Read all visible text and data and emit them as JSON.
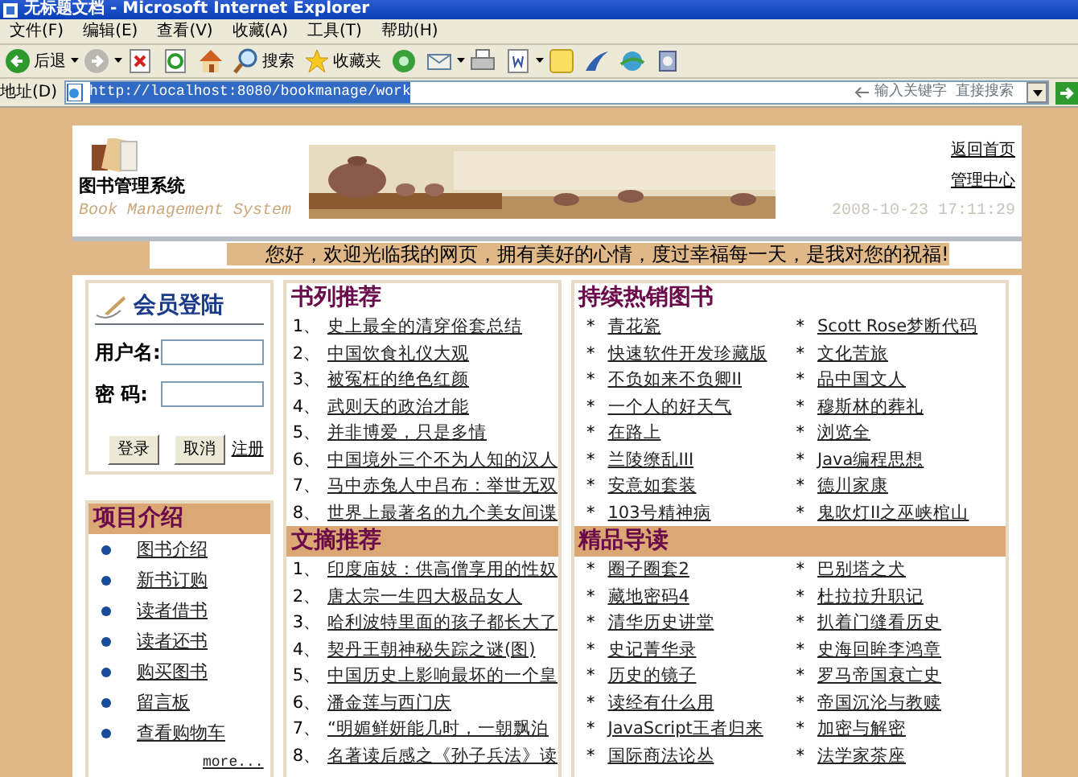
{
  "window": {
    "title": "无标题文档 - Microsoft Internet Explorer"
  },
  "menu": [
    "文件(F)",
    "编辑(E)",
    "查看(V)",
    "收藏(A)",
    "工具(T)",
    "帮助(H)"
  ],
  "toolbar": {
    "back_label": "后退",
    "search_label": "搜索",
    "favorites_label": "收藏夹"
  },
  "address_bar": {
    "label": "地址(D)",
    "url": "http://localhost:8080/bookmanage/work",
    "search_hint": "输入关键字 直接搜索"
  },
  "header": {
    "logo_title": "图书管理系统",
    "logo_subtitle": "Book Management System",
    "links": [
      "返回首页",
      "管理中心"
    ],
    "datetime": "2008-10-23 17:11:29"
  },
  "welcome": "您好，欢迎光临我的网页，拥有美好的心情，度过幸福每一天，是我对您的祝福!",
  "login": {
    "title": "会员登陆",
    "fields": [
      {
        "label": "用户名:"
      },
      {
        "label": "密  码:"
      }
    ],
    "buttons": [
      "登录",
      "取消"
    ],
    "register_link": "注册"
  },
  "project": {
    "title": "项目介绍",
    "items": [
      "图书介绍",
      "新书订购",
      "读者借书",
      "读者还书",
      "购买图书",
      "留言板",
      "查看购物车"
    ],
    "more": "more..."
  },
  "book_recs": {
    "title": "书列推荐",
    "items": [
      {
        "num": "1、",
        "title": "史上最全的清穿俗套总结"
      },
      {
        "num": "2、",
        "title": "中国饮食礼仪大观"
      },
      {
        "num": "3、",
        "title": "被冤枉的绝色红颜"
      },
      {
        "num": "4、",
        "title": "武则天的政治才能"
      },
      {
        "num": "5、",
        "title": "并非博爱，只是多情"
      },
      {
        "num": "6、",
        "title": "中国境外三个不为人知的汉人"
      },
      {
        "num": "7、",
        "title": "马中赤兔人中吕布：举世无双"
      },
      {
        "num": "8、",
        "title": "世界上最著名的九个美女间谍"
      }
    ]
  },
  "digest": {
    "title": "文摘推荐",
    "items": [
      {
        "num": "1、",
        "title": "印度庙妓：供高僧享用的性奴"
      },
      {
        "num": "2、",
        "title": "唐太宗一生四大极品女人"
      },
      {
        "num": "3、",
        "title": "哈利波特里面的孩子都长大了"
      },
      {
        "num": "4、",
        "title": "契丹王朝神秘失踪之谜(图)"
      },
      {
        "num": "5、",
        "title": "中国历史上影响最坏的一个皇"
      },
      {
        "num": "6、",
        "title": "潘金莲与西门庆"
      },
      {
        "num": "7、",
        "title": "“明媚鲜妍能几时，一朝飘泊"
      },
      {
        "num": "8、",
        "title": "名著读后感之《孙子兵法》读"
      }
    ]
  },
  "bestsellers": {
    "title": "持续热销图书",
    "bullet": "*",
    "items": [
      "青花瓷",
      "Scott Rose梦断代码",
      "快速软件开发珍藏版",
      "文化苦旅",
      "不负如来不负卿II",
      "品中国文人",
      "一个人的好天气",
      "穆斯林的葬礼",
      "在路上",
      "浏览全",
      "兰陵缭乱III",
      "Java编程思想",
      "安意如套装",
      "德川家康",
      "103号精神病",
      "鬼吹灯II之巫峡棺山"
    ]
  },
  "featured": {
    "title": "精品导读",
    "bullet": "*",
    "items": [
      "圈子圈套2",
      "巴别塔之犬",
      "藏地密码4",
      "杜拉拉升职记",
      "清华历史讲堂",
      "扒着门缝看历史",
      "史记菁华录",
      "史海回眸李鸿章",
      "历史的镜子",
      "罗马帝国衰亡史",
      "读经有什么用",
      "帝国沉沦与教赎",
      "JavaScript王者归来",
      "加密与解密",
      "国际商法论丛",
      "法学家茶座"
    ]
  }
}
